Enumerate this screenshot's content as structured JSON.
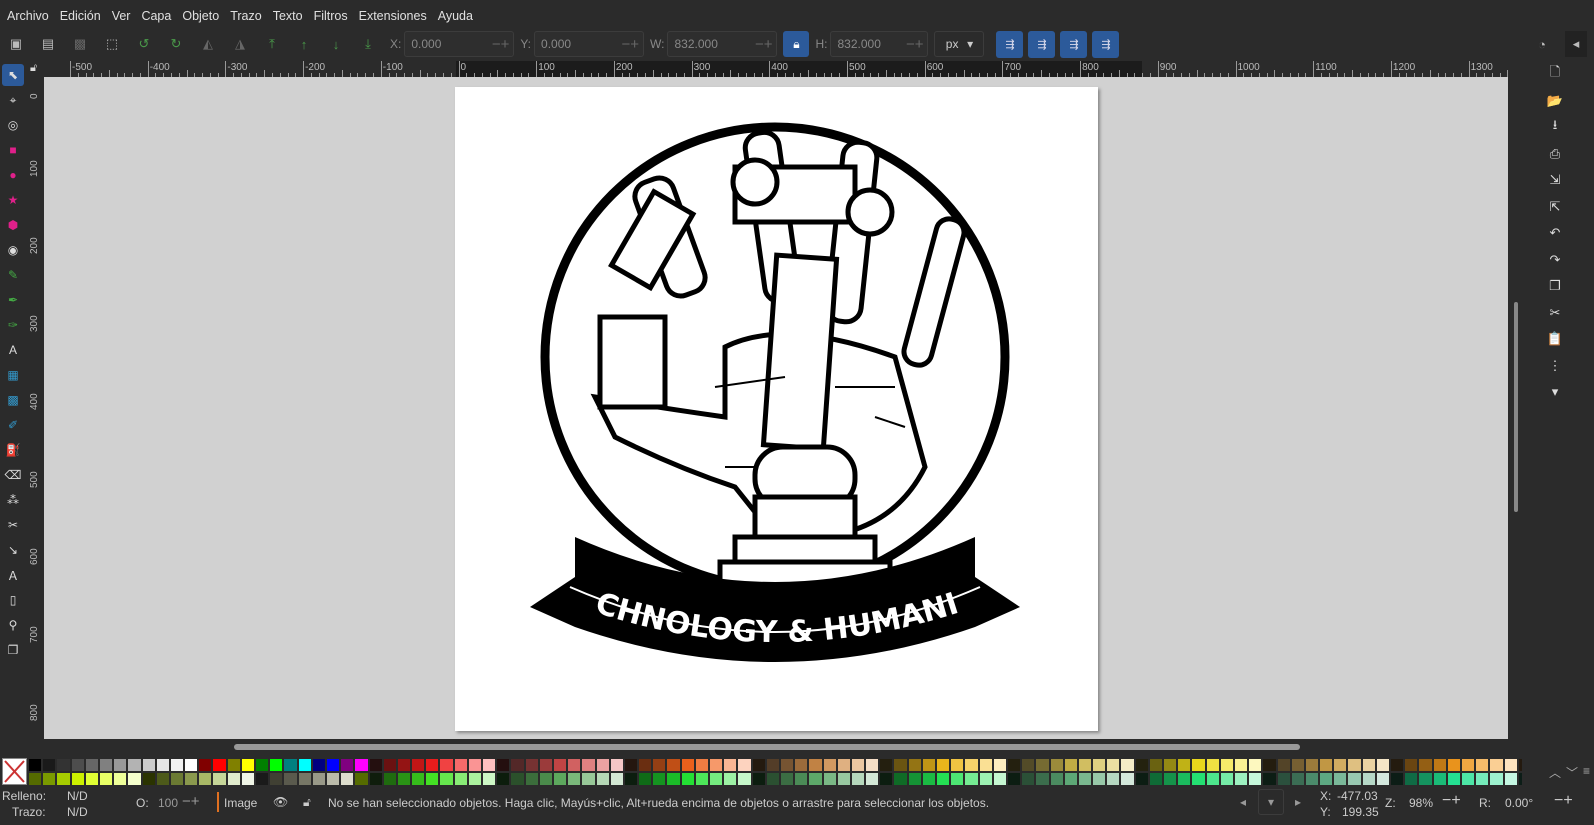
{
  "menu": [
    "Archivo",
    "Edición",
    "Ver",
    "Capa",
    "Objeto",
    "Trazo",
    "Texto",
    "Filtros",
    "Extensiones",
    "Ayuda"
  ],
  "toolbar": {
    "x_label": "X:",
    "x_value": "0.000",
    "y_label": "Y:",
    "y_value": "0.000",
    "w_label": "W:",
    "w_value": "832.000",
    "h_label": "H:",
    "h_value": "832.000",
    "unit": "px"
  },
  "ruler": {
    "h_labels": [
      "-500",
      "-400",
      "-300",
      "-200",
      "-100",
      "0",
      "100",
      "200",
      "300",
      "400",
      "500",
      "600",
      "700",
      "800",
      "900",
      "1000",
      "1100",
      "1200",
      "1300"
    ],
    "v_labels": [
      "0",
      "100",
      "200",
      "300",
      "400",
      "500",
      "600",
      "700",
      "800"
    ]
  },
  "artwork": {
    "banner_text": "TECHNOLOGY & HUMANITY"
  },
  "status": {
    "fill_label": "Relleno:",
    "fill_value": "N/D",
    "stroke_label": "Trazo:",
    "stroke_value": "N/D",
    "opacity_label": "O:",
    "opacity_value": "100",
    "layer": "Image",
    "message": "No se han seleccionado objetos. Haga clic, Mayús+clic, Alt+rueda encima de objetos o arrastre para seleccionar los objetos.",
    "x_label": "X:",
    "x_value": "-477.03",
    "y_label": "Y:",
    "y_value": "199.35",
    "zoom_label": "Z:",
    "zoom_value": "98%",
    "rotate_label": "R:",
    "rotate_value": "0.00°"
  },
  "palette_colors": {
    "accent": "#2c5a9a"
  }
}
